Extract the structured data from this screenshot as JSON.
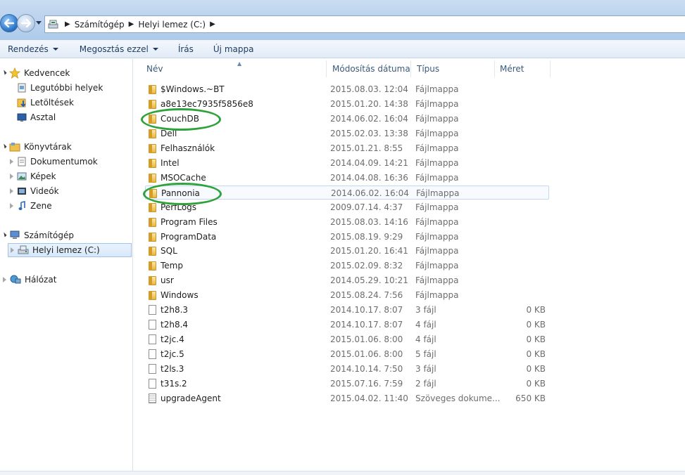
{
  "address": {
    "crumbs": [
      "Számítógép",
      "Helyi lemez (C:)"
    ]
  },
  "toolbar": {
    "organize": "Rendezés",
    "share": "Megosztás ezzel",
    "burn": "Írás",
    "new_folder": "Új mappa"
  },
  "nav": {
    "favorites": "Kedvencek",
    "recent": "Legutóbbi helyek",
    "downloads": "Letöltések",
    "desktop": "Asztal",
    "libraries": "Könyvtárak",
    "documents": "Dokumentumok",
    "pictures": "Képek",
    "videos": "Videók",
    "music": "Zene",
    "computer": "Számítógép",
    "local_disk": "Helyi lemez (C:)",
    "network": "Hálózat"
  },
  "columns": {
    "name": "Név",
    "modified": "Módosítás dátuma",
    "type": "Típus",
    "size": "Méret"
  },
  "files": [
    {
      "name": "$Windows.~BT",
      "date": "2015.08.03. 12:04",
      "type": "Fájlmappa",
      "size": "",
      "icon": "folder-icon"
    },
    {
      "name": "a8e13ec7935f5856e8",
      "date": "2015.01.20. 14:38",
      "type": "Fájlmappa",
      "size": "",
      "icon": "folder-icon"
    },
    {
      "name": "CouchDB",
      "date": "2014.06.02. 16:04",
      "type": "Fájlmappa",
      "size": "",
      "icon": "folder-icon"
    },
    {
      "name": "Dell",
      "date": "2015.02.03. 13:38",
      "type": "Fájlmappa",
      "size": "",
      "icon": "folder-icon"
    },
    {
      "name": "Felhasználók",
      "date": "2015.01.21. 8:55",
      "type": "Fájlmappa",
      "size": "",
      "icon": "folder-icon"
    },
    {
      "name": "Intel",
      "date": "2014.04.09. 14:21",
      "type": "Fájlmappa",
      "size": "",
      "icon": "folder-icon"
    },
    {
      "name": "MSOCache",
      "date": "2014.04.08. 16:36",
      "type": "Fájlmappa",
      "size": "",
      "icon": "folder-icon"
    },
    {
      "name": "Pannonia",
      "date": "2014.06.02. 16:04",
      "type": "Fájlmappa",
      "size": "",
      "icon": "folder-icon"
    },
    {
      "name": "PerfLogs",
      "date": "2009.07.14. 4:37",
      "type": "Fájlmappa",
      "size": "",
      "icon": "folder-icon"
    },
    {
      "name": "Program Files",
      "date": "2015.08.03. 14:16",
      "type": "Fájlmappa",
      "size": "",
      "icon": "folder-icon"
    },
    {
      "name": "ProgramData",
      "date": "2015.08.19. 9:29",
      "type": "Fájlmappa",
      "size": "",
      "icon": "folder-icon"
    },
    {
      "name": "SQL",
      "date": "2015.01.20. 16:41",
      "type": "Fájlmappa",
      "size": "",
      "icon": "folder-icon"
    },
    {
      "name": "Temp",
      "date": "2015.02.09. 8:32",
      "type": "Fájlmappa",
      "size": "",
      "icon": "folder-icon"
    },
    {
      "name": "usr",
      "date": "2014.05.29. 10:21",
      "type": "Fájlmappa",
      "size": "",
      "icon": "folder-icon"
    },
    {
      "name": "Windows",
      "date": "2015.08.24. 7:56",
      "type": "Fájlmappa",
      "size": "",
      "icon": "folder-icon"
    },
    {
      "name": "t2h8.3",
      "date": "2014.10.17. 8:07",
      "type": "3 fájl",
      "size": "0 KB",
      "icon": "file-icon"
    },
    {
      "name": "t2h8.4",
      "date": "2014.10.17. 8:07",
      "type": "4 fájl",
      "size": "0 KB",
      "icon": "file-icon"
    },
    {
      "name": "t2jc.4",
      "date": "2015.01.06. 8:00",
      "type": "4 fájl",
      "size": "0 KB",
      "icon": "file-icon"
    },
    {
      "name": "t2jc.5",
      "date": "2015.01.06. 8:00",
      "type": "5 fájl",
      "size": "0 KB",
      "icon": "file-icon"
    },
    {
      "name": "t2ls.3",
      "date": "2014.10.14. 7:50",
      "type": "3 fájl",
      "size": "0 KB",
      "icon": "file-icon"
    },
    {
      "name": "t31s.2",
      "date": "2015.07.16. 7:59",
      "type": "2 fájl",
      "size": "0 KB",
      "icon": "file-icon"
    },
    {
      "name": "upgradeAgent",
      "date": "2015.04.02. 11:40",
      "type": "Szöveges dokume...",
      "size": "650 KB",
      "icon": "text-document-icon"
    }
  ],
  "highlighted_row": "Pannonia",
  "colors": {
    "annotation_circle": "#2fa23c",
    "selection_border": "#9fc3ea"
  }
}
